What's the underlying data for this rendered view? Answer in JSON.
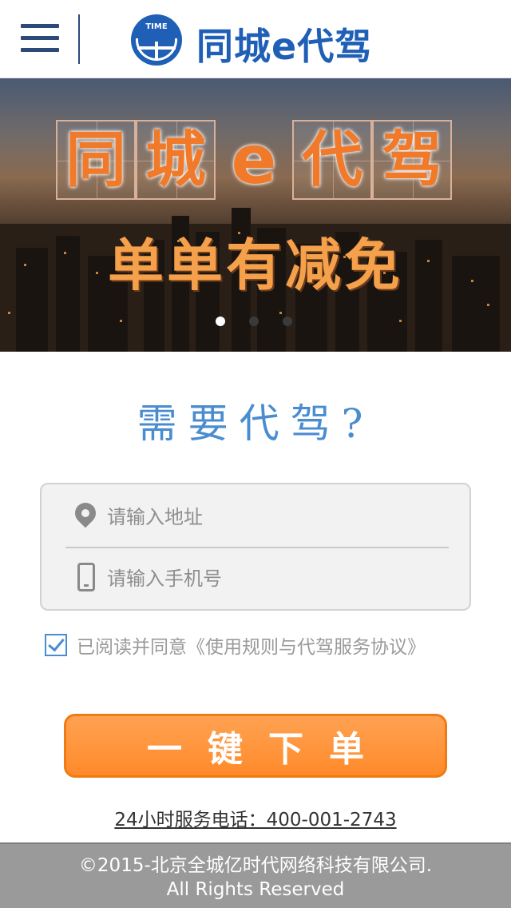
{
  "header": {
    "brand": "同城e代驾",
    "logo_text": "TIME"
  },
  "banner": {
    "title_chars": [
      "同",
      "城",
      "e",
      "代",
      "驾"
    ],
    "subtitle": "单单有减免",
    "slides": 3,
    "active_slide": 1
  },
  "question": "需要代驾?",
  "form": {
    "address_placeholder": "请输入地址",
    "phone_placeholder": "请输入手机号",
    "address_value": "",
    "phone_value": ""
  },
  "agreement": {
    "checked": true,
    "text": "已阅读并同意《使用规则与代驾服务协议》"
  },
  "submit_label": "一键下单",
  "hotline": "24小时服务电话：400-001-2743",
  "footer": {
    "line1": "©2015-北京全城亿时代网络科技有限公司.",
    "line2": "All Rights Reserved"
  },
  "colors": {
    "brand_blue": "#1f5fb6",
    "accent_orange": "#ff8a2a",
    "question_blue": "#4a8cd0",
    "footer_gray": "#9a9a9a"
  }
}
